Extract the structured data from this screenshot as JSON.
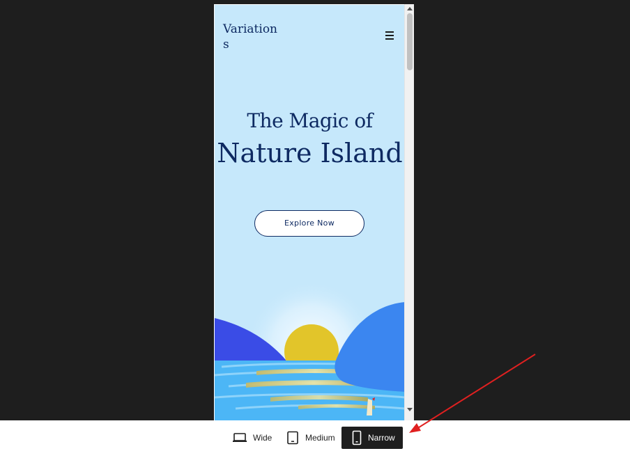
{
  "site": {
    "title": "Variations"
  },
  "hero": {
    "subtitle": "The Magic of",
    "title": "Nature Island",
    "cta_label": "Explore Now"
  },
  "icons": {
    "menu": "hamburger-menu-icon",
    "wide": "laptop-icon",
    "medium": "tablet-icon",
    "narrow": "phone-icon"
  },
  "toolbar": {
    "wide_label": "Wide",
    "medium_label": "Medium",
    "narrow_label": "Narrow",
    "selected": "Narrow"
  },
  "colors": {
    "sky": "#c6e8fb",
    "heading": "#0e2a62",
    "sun": "#e2c52a",
    "hill_left": "#3a4ce6",
    "hill_right": "#3b86f0",
    "sea": "#4cb6f6",
    "annotation_arrow": "#e02020",
    "selected_button": "#1e1e1e"
  }
}
